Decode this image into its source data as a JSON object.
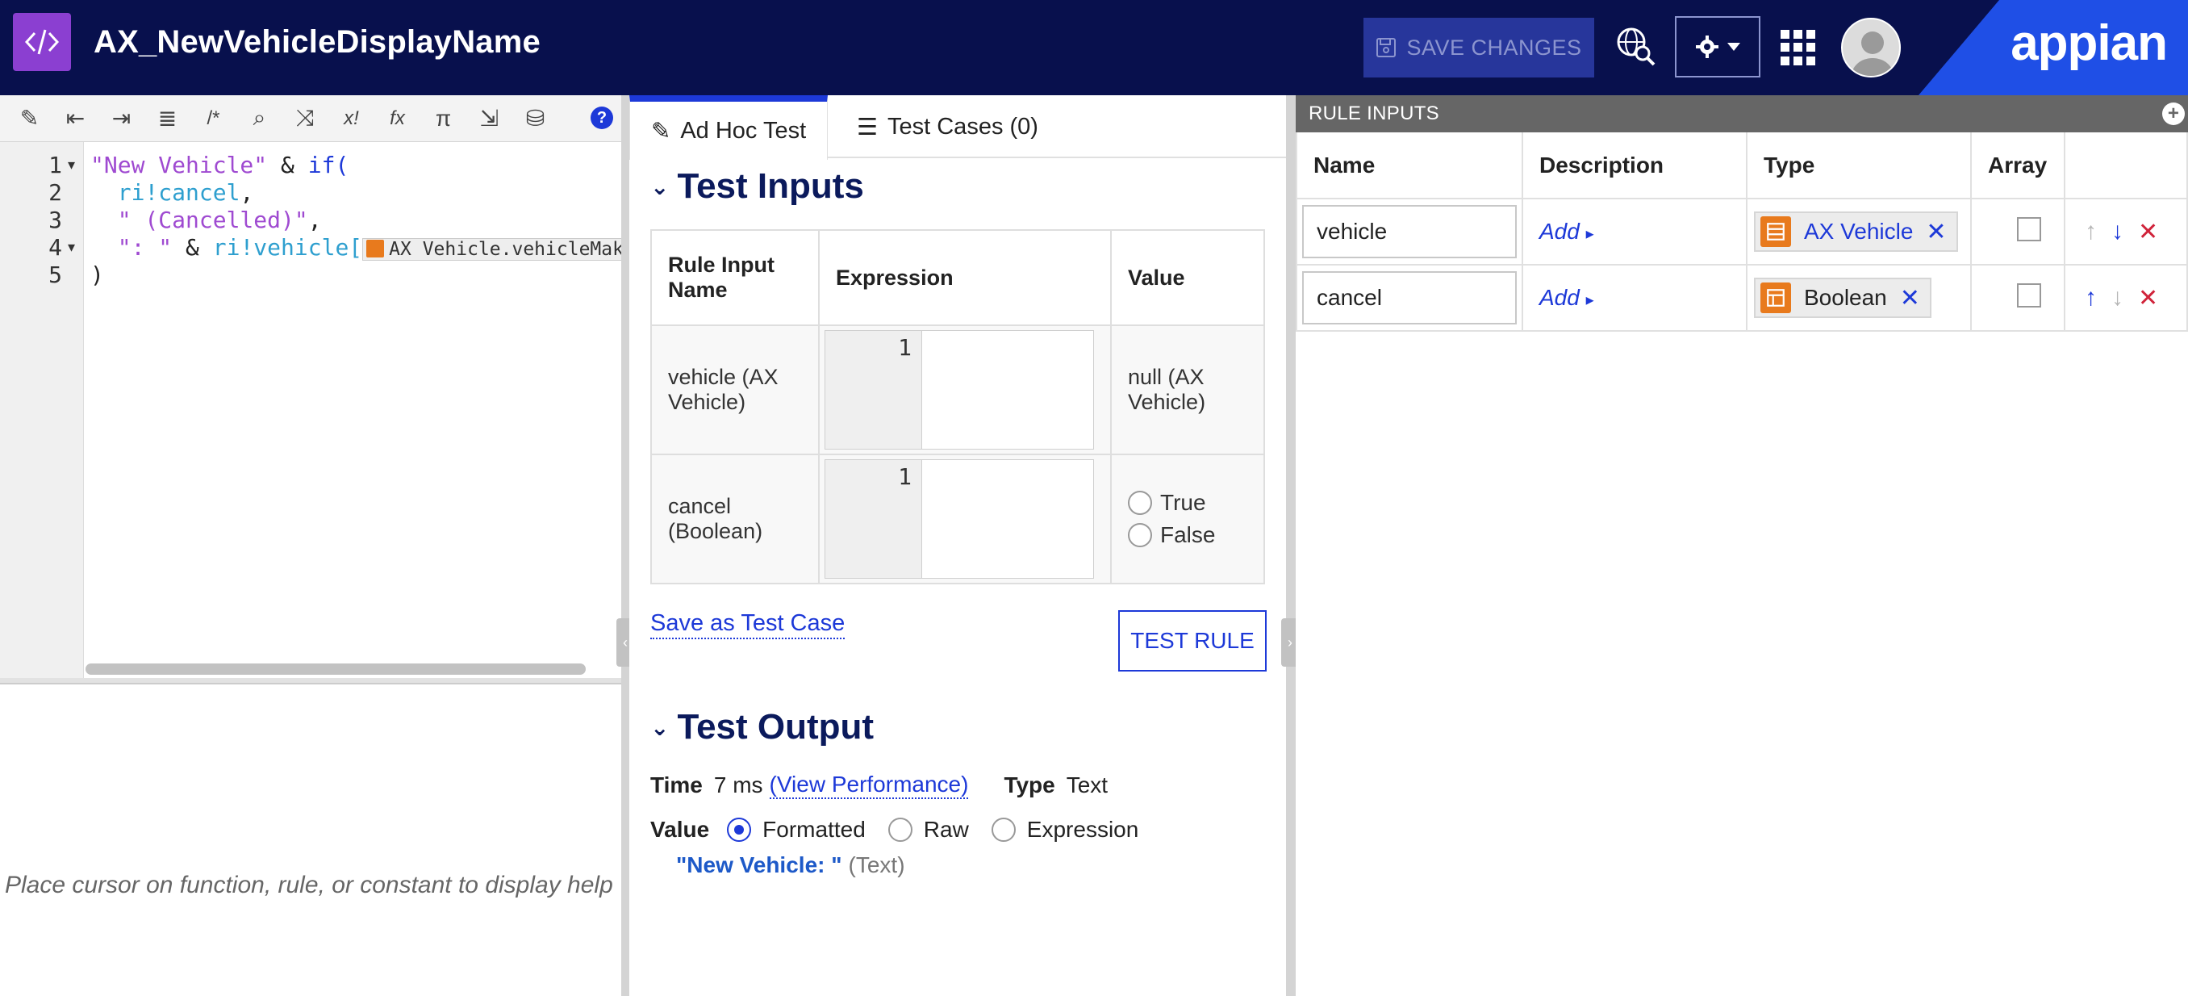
{
  "header": {
    "title": "AX_NewVehicleDisplayName",
    "save_label": "SAVE CHANGES",
    "brand": "appian"
  },
  "editor": {
    "toolbar_icons": [
      "magic-wand-icon",
      "outdent-icon",
      "indent-icon",
      "format-icon",
      "comment-icon",
      "search-icon",
      "shuffle-icon",
      "variable-icon",
      "function-icon",
      "pi-icon",
      "export-icon",
      "database-icon",
      "help-icon"
    ],
    "help_label": "?",
    "lines": [
      "1",
      "2",
      "3",
      "4",
      "5"
    ],
    "code": {
      "l1_str": "\"New Vehicle\"",
      "l1_op": " & ",
      "l1_kw": "if(",
      "l2_ri": "  ri!cancel",
      "l2_op": ",",
      "l3_str": "  \" (Cancelled)\"",
      "l3_op": ",",
      "l4_str": "  \": \"",
      "l4_op": " & ",
      "l4_ri": "ri!vehicle[",
      "l4_chip": "AX Vehicle.vehicleMake",
      "l5": ")"
    },
    "help_text": "Place cursor on function, rule, or constant to display help"
  },
  "test": {
    "tabs": [
      {
        "label": "Ad Hoc Test"
      },
      {
        "label": "Test Cases (0)"
      }
    ],
    "inputs_title": "Test Inputs",
    "columns": {
      "name": "Rule Input Name",
      "expression": "Expression",
      "value": "Value"
    },
    "rows": [
      {
        "name": "vehicle (AX Vehicle)",
        "line": "1",
        "value": "null (AX Vehicle)"
      },
      {
        "name": "cancel (Boolean)",
        "line": "1",
        "opt_true": "True",
        "opt_false": "False"
      }
    ],
    "save_link": "Save as Test Case",
    "test_rule": "TEST RULE",
    "output_title": "Test Output",
    "time_label": "Time",
    "time_value": "7 ms",
    "perf_link": "(View Performance)",
    "type_label": "Type",
    "type_value": "Text",
    "value_label": "Value",
    "value_options": [
      "Formatted",
      "Raw",
      "Expression"
    ],
    "value_selected": "Formatted",
    "result_str": "\"New Vehicle: \"",
    "result_type": "(Text)"
  },
  "rule_inputs": {
    "bar_title": "RULE INPUTS",
    "columns": {
      "name": "Name",
      "description": "Description",
      "type": "Type",
      "array": "Array"
    },
    "rows": [
      {
        "name": "vehicle",
        "desc": "Add",
        "type": "AX Vehicle",
        "array": false
      },
      {
        "name": "cancel",
        "desc": "Add",
        "type": "Boolean",
        "array": false
      }
    ]
  },
  "colors": {
    "header_bg": "#08104d",
    "accent": "#1d39d8",
    "brand": "#1f4fe6",
    "delete": "#d0233a",
    "type_icon": "#e87a1d"
  }
}
